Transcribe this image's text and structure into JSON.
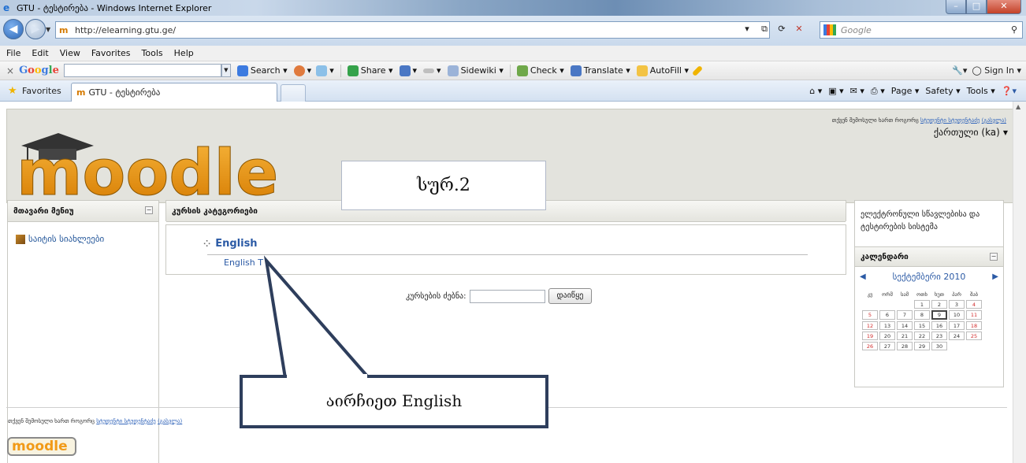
{
  "window": {
    "title": "GTU - ტესტირება - Windows Internet Explorer"
  },
  "addressbar": {
    "url": "http://elearning.gtu.ge/",
    "search_placeholder": "Google"
  },
  "menubar": [
    "File",
    "Edit",
    "View",
    "Favorites",
    "Tools",
    "Help"
  ],
  "gtoolbar": {
    "close": "×",
    "search_label": "Search",
    "share_label": "Share",
    "sidewiki_label": "Sidewiki",
    "check_label": "Check",
    "translate_label": "Translate",
    "autofill_label": "AutoFill",
    "signin_label": "Sign In"
  },
  "favbar": {
    "favorites_label": "Favorites",
    "tab_title": "GTU - ტესტირება",
    "cmd_page": "Page",
    "cmd_safety": "Safety",
    "cmd_tools": "Tools"
  },
  "header": {
    "logged_prefix": "თქვენ შემოსული ხართ როგორც",
    "logged_user": "სტუდენტი სტუდენტაძე",
    "logout": "(გასვლა)",
    "language": "ქართული (ka)"
  },
  "main_menu": {
    "title": "მთავარი მენიუ",
    "item": "საიტის სიახლეები"
  },
  "categories": {
    "title": "კურსის კატეგორიები",
    "category": "English",
    "course": "English T"
  },
  "course_search": {
    "label": "კურსების ძებნა:",
    "button": "დაიწყე"
  },
  "right": {
    "system_text": "ელექტრონული სწავლებისა და ტესტირების სისტემა",
    "calendar_title": "კალენდარი",
    "month": "სექტემბერი 2010",
    "weekdays": [
      "კვ",
      "ორშ",
      "სამ",
      "ოთხ",
      "ხუთ",
      "პარ",
      "შაბ"
    ],
    "weeks": [
      [
        "",
        "",
        "",
        "1",
        "2",
        "3",
        "4"
      ],
      [
        "5",
        "6",
        "7",
        "8",
        "9",
        "10",
        "11"
      ],
      [
        "12",
        "13",
        "14",
        "15",
        "16",
        "17",
        "18"
      ],
      [
        "19",
        "20",
        "21",
        "22",
        "23",
        "24",
        "25"
      ],
      [
        "26",
        "27",
        "28",
        "29",
        "30",
        "",
        ""
      ]
    ],
    "today": "9"
  },
  "footer": {
    "logo_text": "moodle"
  },
  "annotations": {
    "figure_label": "სურ.2",
    "instruction": "აირჩიეთ English"
  }
}
